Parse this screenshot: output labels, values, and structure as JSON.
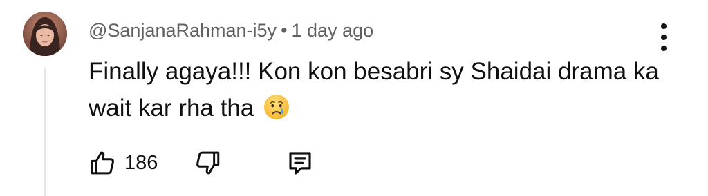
{
  "comment": {
    "author": "@SanjanaRahman-i5y",
    "separator": "•",
    "time": "1 day ago",
    "text": "Finally agaya!!! Kon kon besabri sy Shaidai drama ka wait kar rha tha",
    "emoji": "crying-face-emoji"
  },
  "actions": {
    "like_count": "186",
    "like_icon": "thumb-up-icon",
    "dislike_icon": "thumb-down-icon",
    "reply_icon": "reply-comment-icon"
  },
  "menu_icon": "more-vertical-icon",
  "colors": {
    "meta_text": "#606060",
    "body_text": "#0f0f0f",
    "thread_line": "#e6e6e6"
  }
}
